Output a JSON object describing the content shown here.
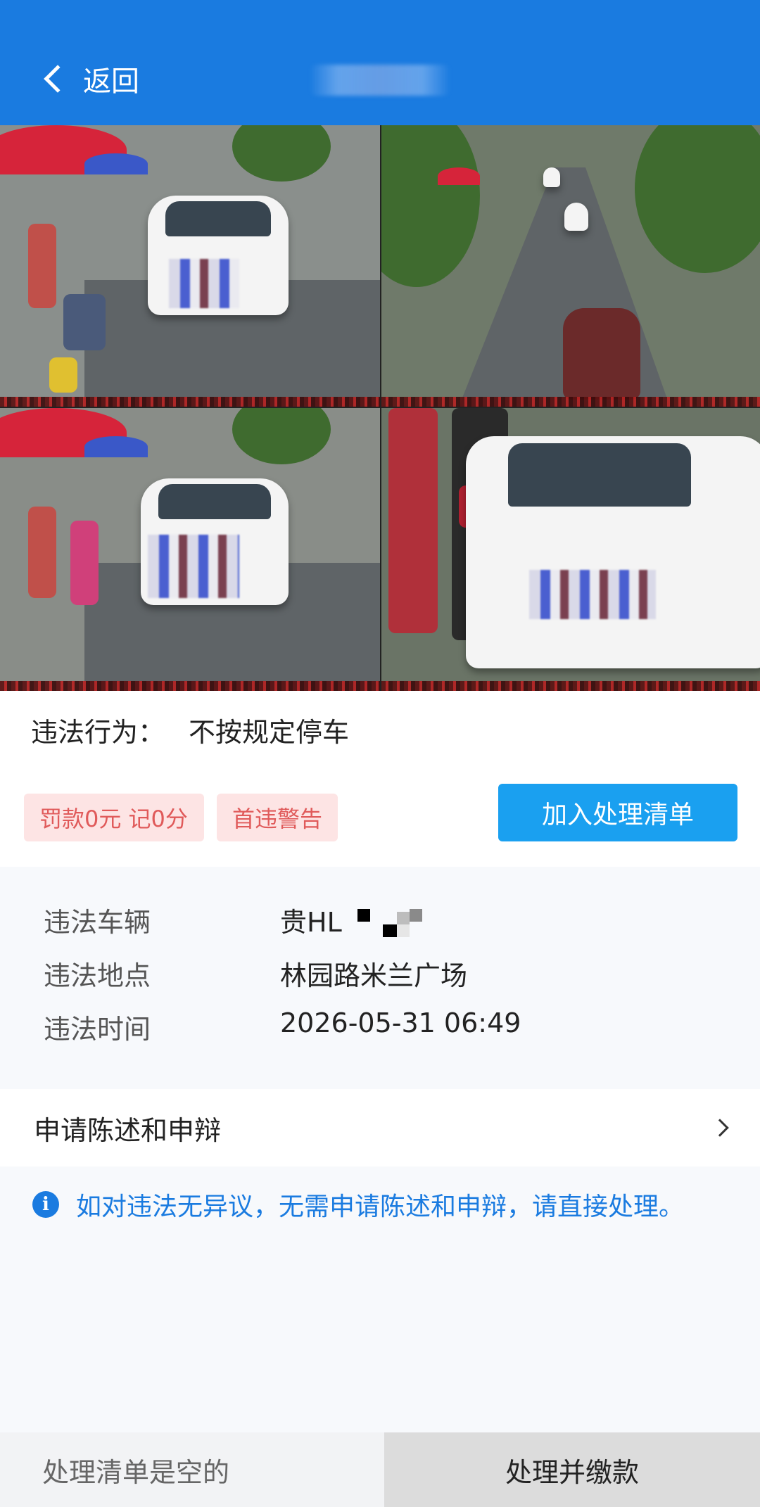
{
  "header": {
    "back_label": "返回",
    "title": ""
  },
  "photos": {
    "count": 4,
    "active_index": 0
  },
  "violation": {
    "behavior_label": "违法行为：",
    "behavior_value": "不按规定停车",
    "fine_tag": "罚款0元  记0分",
    "warning_tag": "首违警告",
    "add_button": "加入处理清单"
  },
  "details": {
    "vehicle_label": "违法车辆",
    "vehicle_value": "贵HL",
    "location_label": "违法地点",
    "location_value": "林园路米兰广场",
    "time_label": "违法时间",
    "time_value": "2026-05-31 06:49"
  },
  "appeal": {
    "label": "申请陈述和申辩"
  },
  "notice": {
    "text": "如对违法无异议，无需申请陈述和申辩，请直接处理。"
  },
  "bottom": {
    "cart_status": "处理清单是空的",
    "pay_button": "处理并缴款"
  },
  "colors": {
    "primary": "#1a7be0",
    "button": "#1aa0f0",
    "tag_bg": "#fde4e4",
    "tag_text": "#e05a5a"
  }
}
